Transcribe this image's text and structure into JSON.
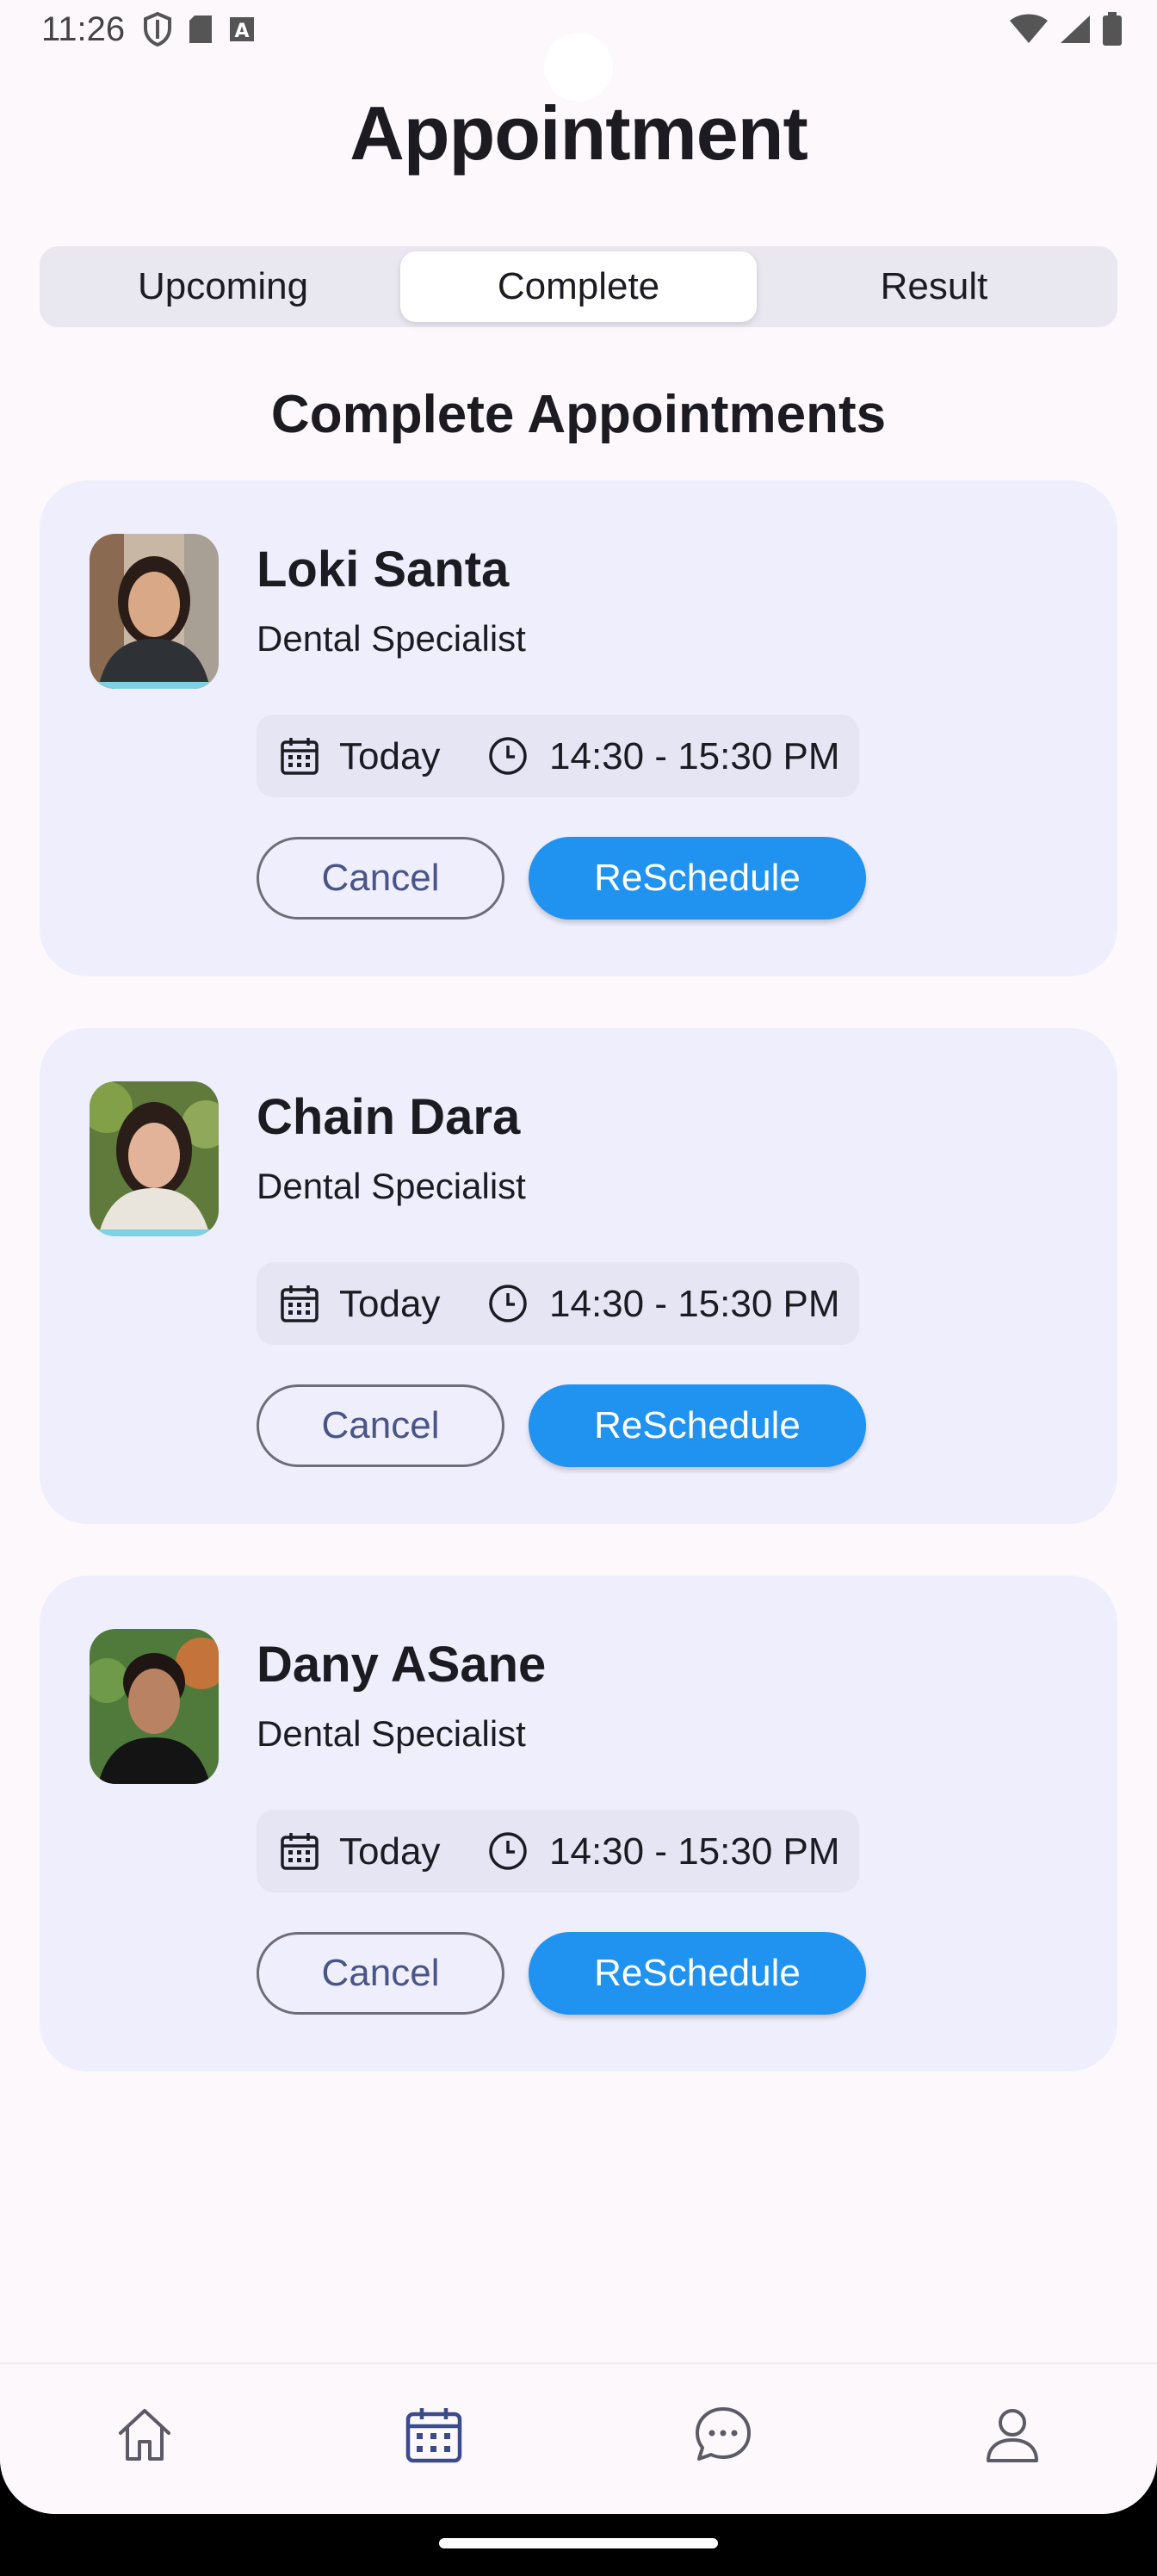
{
  "status_bar": {
    "time": "11:26",
    "left_icons": [
      "shield-icon",
      "sd-card-icon",
      "text-a-icon"
    ],
    "right_icons": [
      "wifi-icon",
      "signal-icon",
      "battery-icon"
    ]
  },
  "header": {
    "title": "Appointment"
  },
  "tabs": [
    {
      "label": "Upcoming",
      "active": false
    },
    {
      "label": "Complete",
      "active": true
    },
    {
      "label": "Result",
      "active": false
    }
  ],
  "section_title": "Complete Appointments",
  "appointments": [
    {
      "name": "Loki Santa",
      "specialty": "Dental Specialist",
      "day": "Today",
      "time": "14:30 - 15:30 PM",
      "cancel_label": "Cancel",
      "reschedule_label": "ReSchedule"
    },
    {
      "name": "Chain Dara",
      "specialty": "Dental Specialist",
      "day": "Today",
      "time": "14:30 - 15:30 PM",
      "cancel_label": "Cancel",
      "reschedule_label": "ReSchedule"
    },
    {
      "name": "Dany ASane",
      "specialty": "Dental Specialist",
      "day": "Today",
      "time": "14:30 - 15:30 PM",
      "cancel_label": "Cancel",
      "reschedule_label": "ReSchedule"
    }
  ],
  "bottom_nav": [
    {
      "icon": "home-icon",
      "active": false
    },
    {
      "icon": "calendar-icon",
      "active": true
    },
    {
      "icon": "chat-icon",
      "active": false
    },
    {
      "icon": "profile-icon",
      "active": false
    }
  ],
  "colors": {
    "accent": "#1f93ef",
    "card_background": "#efeefc",
    "page_background": "#fcf8fc",
    "nav_active": "#3c4a8c",
    "nav_inactive": "#5b5a66"
  }
}
